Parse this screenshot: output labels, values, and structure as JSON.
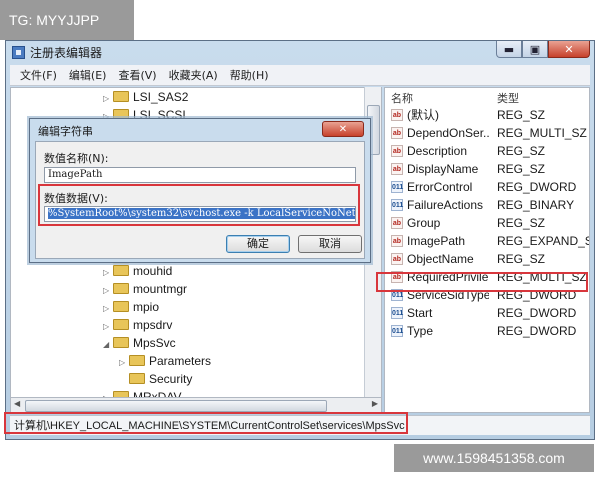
{
  "overlay_label": "TG: MYYJJPP",
  "watermark": "www.1598451358.com",
  "window": {
    "title": "注册表编辑器",
    "controls": {
      "minimize": "▬",
      "maximize": "▣",
      "close": "✕"
    }
  },
  "menu": [
    "文件(F)",
    "编辑(E)",
    "查看(V)",
    "收藏夹(A)",
    "帮助(H)"
  ],
  "tree": {
    "visible_top": [
      {
        "label": "LSI_SAS2",
        "expander": "▷"
      },
      {
        "label": "LSI_SCSI",
        "expander": "▷"
      }
    ],
    "visible_bottom": [
      {
        "label": "mouhid",
        "expander": "▷"
      },
      {
        "label": "mountmgr",
        "expander": "▷"
      },
      {
        "label": "mpio",
        "expander": "▷"
      },
      {
        "label": "mpsdrv",
        "expander": "▷"
      },
      {
        "label": "MpsSvc",
        "expander": "◢"
      },
      {
        "label": "Parameters",
        "expander": "▷"
      },
      {
        "label": "Security",
        "expander": ""
      },
      {
        "label": "MRxDAV",
        "expander": "▷"
      }
    ]
  },
  "values_panel": {
    "headers": {
      "name": "名称",
      "type": "类型"
    },
    "rows": [
      {
        "icon": "string-value-icon",
        "icon_text": "ab",
        "name": "(默认)",
        "type": "REG_SZ"
      },
      {
        "icon": "string-value-icon",
        "icon_text": "ab",
        "name": "DependOnSer...",
        "type": "REG_MULTI_SZ"
      },
      {
        "icon": "string-value-icon",
        "icon_text": "ab",
        "name": "Description",
        "type": "REG_SZ"
      },
      {
        "icon": "string-value-icon",
        "icon_text": "ab",
        "name": "DisplayName",
        "type": "REG_SZ"
      },
      {
        "icon": "binary-value-icon",
        "icon_text": "011",
        "name": "ErrorControl",
        "type": "REG_DWORD"
      },
      {
        "icon": "binary-value-icon",
        "icon_text": "011",
        "name": "FailureActions",
        "type": "REG_BINARY"
      },
      {
        "icon": "string-value-icon",
        "icon_text": "ab",
        "name": "Group",
        "type": "REG_SZ"
      },
      {
        "icon": "string-value-icon",
        "icon_text": "ab",
        "name": "ImagePath",
        "type": "REG_EXPAND_SZ"
      },
      {
        "icon": "string-value-icon",
        "icon_text": "ab",
        "name": "ObjectName",
        "type": "REG_SZ"
      },
      {
        "icon": "string-value-icon",
        "icon_text": "ab",
        "name": "RequiredPrivile...",
        "type": "REG_MULTI_SZ"
      },
      {
        "icon": "binary-value-icon",
        "icon_text": "011",
        "name": "ServiceSidType",
        "type": "REG_DWORD"
      },
      {
        "icon": "binary-value-icon",
        "icon_text": "011",
        "name": "Start",
        "type": "REG_DWORD"
      },
      {
        "icon": "binary-value-icon",
        "icon_text": "011",
        "name": "Type",
        "type": "REG_DWORD"
      }
    ]
  },
  "status_bar": "计算机\\HKEY_LOCAL_MACHINE\\SYSTEM\\CurrentControlSet\\services\\MpsSvc",
  "dialog": {
    "title": "编辑字符串",
    "close": "✕",
    "name_label": "数值名称(N):",
    "name_value": "ImagePath",
    "data_label": "数值数据(V):",
    "data_value": "%SystemRoot%\\system32\\svchost.exe -k LocalServiceNoNetwork",
    "ok_label": "确定",
    "cancel_label": "取消"
  },
  "colors": {
    "highlight_border": "#d8363c",
    "selection": "#3b73c6",
    "window_frame": "#c9dced"
  }
}
